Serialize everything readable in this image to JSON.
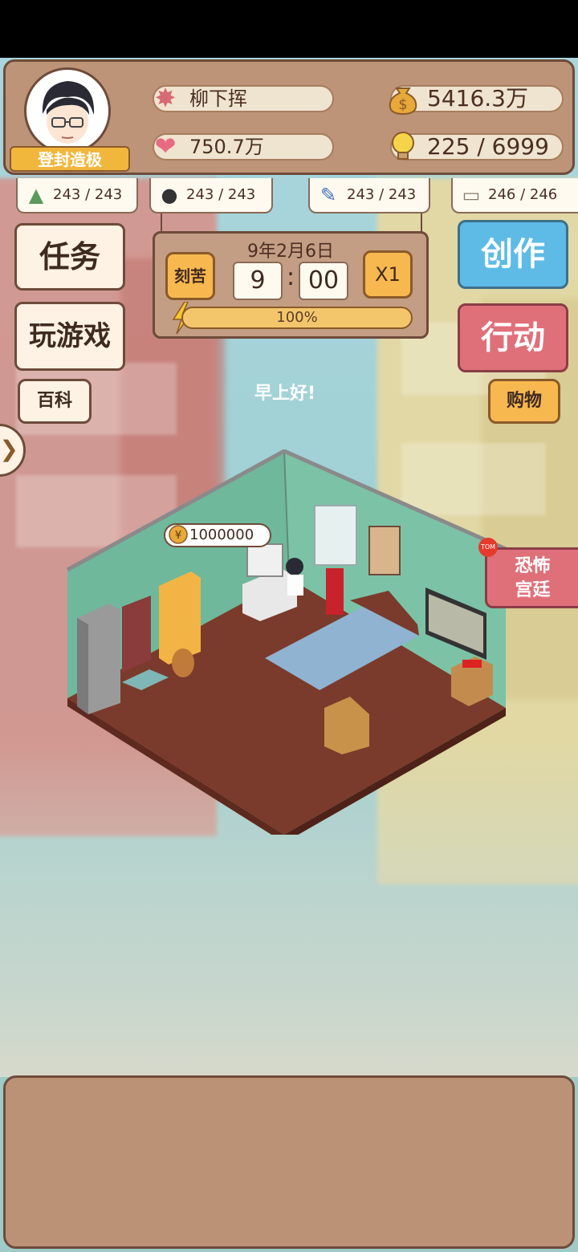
{
  "player": {
    "name": "柳下挥",
    "title": "登封造极",
    "fans": "750.7万",
    "money": "5416.3万",
    "inspiration": "225 / 6999"
  },
  "skills": [
    {
      "icon": "mountain-icon",
      "value": "243 / 243"
    },
    {
      "icon": "hat-icon",
      "value": "243 / 243"
    },
    {
      "icon": "brush-icon",
      "value": "243 / 243"
    },
    {
      "icon": "book-icon",
      "value": "246 / 246"
    }
  ],
  "left_buttons": {
    "tasks": "任务",
    "play_game": "玩游戏",
    "encyclopedia": "百科"
  },
  "right_buttons": {
    "create": "创作",
    "action": "行动",
    "shop": "购物"
  },
  "clock": {
    "date": "9年2月6日",
    "mode": "刻苦",
    "hour": "9",
    "separator": ":",
    "minute": "00",
    "speed": "X1",
    "energy": "100%",
    "energy_fraction": 1.0
  },
  "greeting": "早上好!",
  "room": {
    "money_bubble": "1000000"
  },
  "ad": {
    "label_line1": "恐怖",
    "label_line2": "宫廷",
    "badge": "TOM"
  },
  "colors": {
    "panel": "#bd9478",
    "blue_button": "#5dbbe6",
    "red_button": "#df707a",
    "orange_button": "#f7b84f"
  }
}
